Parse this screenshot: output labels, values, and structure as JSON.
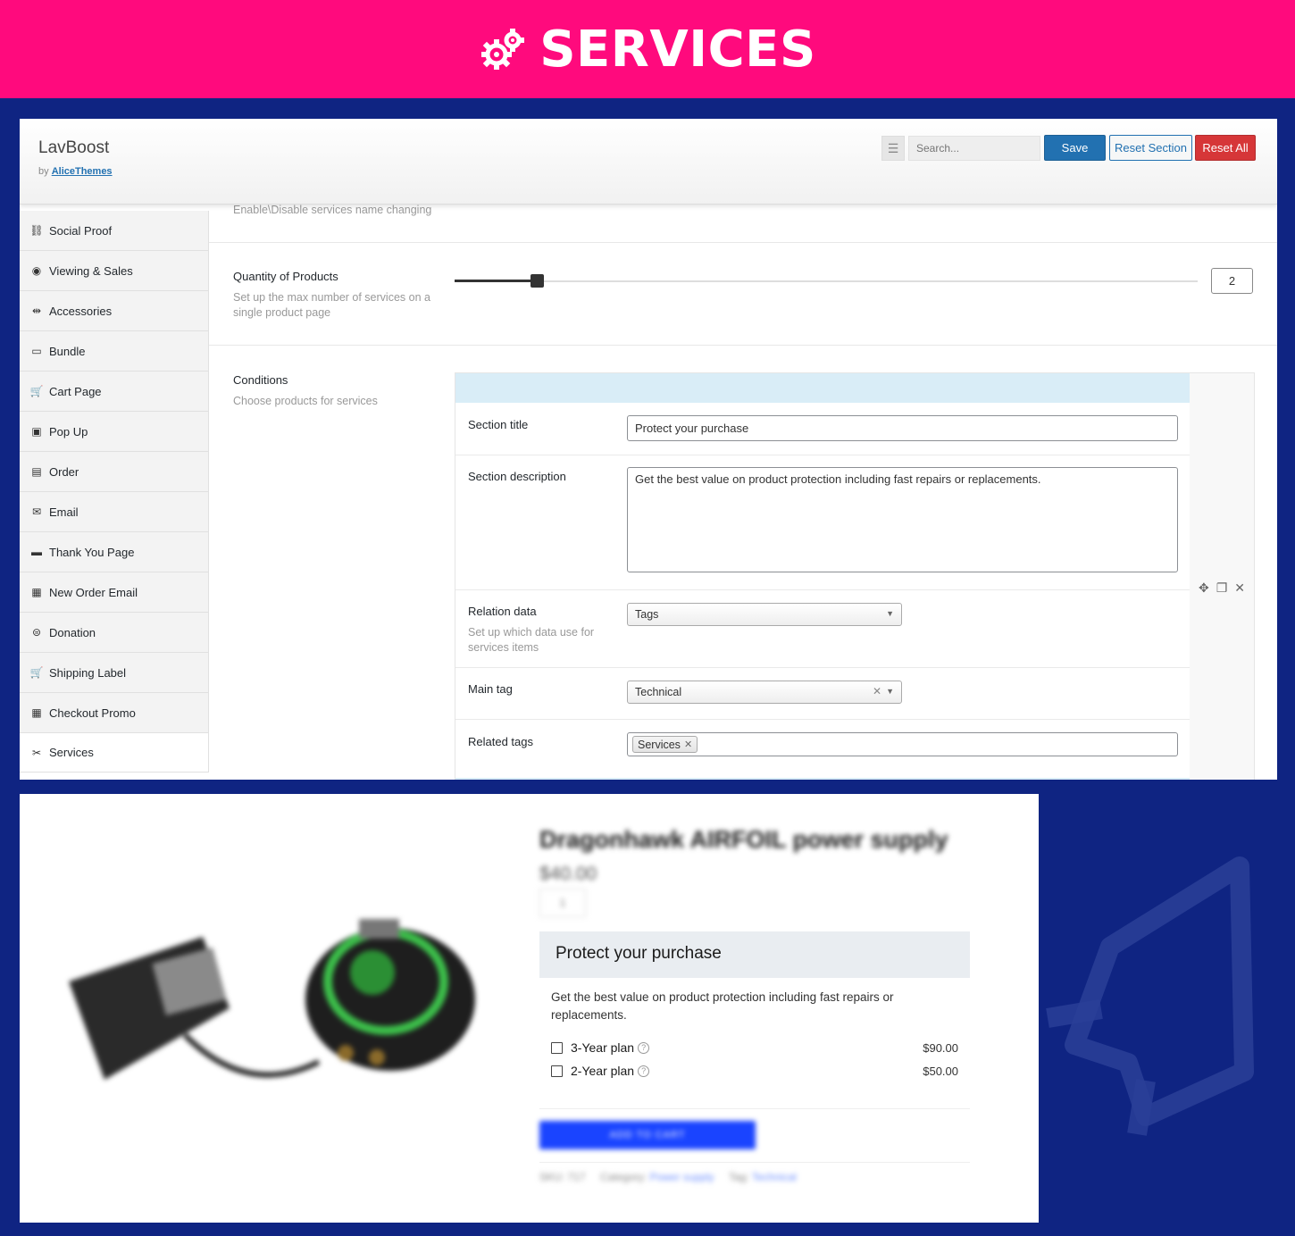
{
  "banner": {
    "title": "SERVICES",
    "icon": "gears-icon"
  },
  "admin": {
    "brand": "LavBoost",
    "by_prefix": "by",
    "by_link": "AliceThemes",
    "search_placeholder": "Search...",
    "buttons": {
      "save": "Save",
      "reset_section": "Reset Section",
      "reset_all": "Reset All"
    },
    "sidebar": [
      {
        "label": "Social Proof",
        "icon": "social-proof-icon"
      },
      {
        "label": "Viewing & Sales",
        "icon": "eye-icon"
      },
      {
        "label": "Accessories",
        "icon": "usb-icon"
      },
      {
        "label": "Bundle",
        "icon": "laptop-icon"
      },
      {
        "label": "Cart Page",
        "icon": "cart-icon"
      },
      {
        "label": "Pop Up",
        "icon": "popup-icon"
      },
      {
        "label": "Order",
        "icon": "document-icon"
      },
      {
        "label": "Email",
        "icon": "envelope-icon"
      },
      {
        "label": "Thank You Page",
        "icon": "card-icon"
      },
      {
        "label": "New Order Email",
        "icon": "store-icon"
      },
      {
        "label": "Donation",
        "icon": "donation-icon"
      },
      {
        "label": "Shipping Label",
        "icon": "cart-icon"
      },
      {
        "label": "Checkout Promo",
        "icon": "store-icon"
      },
      {
        "label": "Services",
        "icon": "tools-icon",
        "active": true
      }
    ],
    "top_hint": "Enable\\Disable services name changing",
    "quantity": {
      "title": "Quantity of Products",
      "subtitle": "Set up the max number of services on a single product page",
      "value": "2",
      "slider_fraction": 0.11
    },
    "conditions": {
      "title": "Conditions",
      "subtitle": "Choose products for services",
      "section_title_label": "Section title",
      "section_title_value": "Protect your purchase",
      "section_desc_label": "Section description",
      "section_desc_value": "Get the best value on product protection including fast repairs or replacements.",
      "relation_label": "Relation data",
      "relation_sub": "Set up which data use for services items",
      "relation_value": "Tags",
      "main_tag_label": "Main tag",
      "main_tag_value": "Technical",
      "related_tags_label": "Related tags",
      "related_tags": [
        "Services"
      ]
    }
  },
  "product": {
    "title": "Dragonhawk AIRFOIL power supply",
    "price": "$40.00",
    "qty": "1",
    "protect_title": "Protect your purchase",
    "protect_desc": "Get the best value on product protection including fast repairs or replacements.",
    "plans": [
      {
        "name": "3-Year plan",
        "price": "$90.00"
      },
      {
        "name": "2-Year plan",
        "price": "$50.00"
      }
    ],
    "help_glyph": "?",
    "add_to_cart": "ADD TO CART",
    "meta": {
      "sku_label": "SKU:",
      "sku": "717",
      "category_label": "Category:",
      "category": "Power supply",
      "tag_label": "Tag:",
      "tag": "Technical"
    }
  },
  "colors": {
    "banner": "#ff0a7d",
    "background": "#0f2482",
    "primary": "#2271b1",
    "danger": "#d63638",
    "cart": "#1a44ff"
  }
}
